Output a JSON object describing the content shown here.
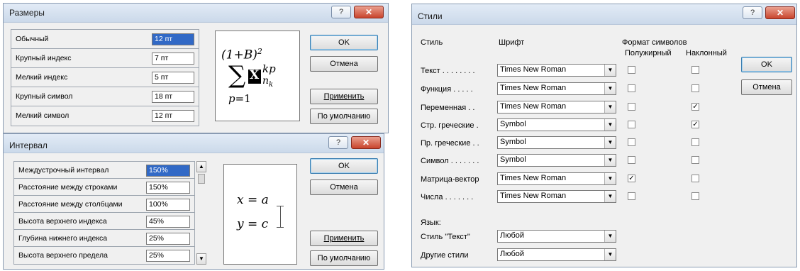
{
  "sizes": {
    "title": "Размеры",
    "help": "?",
    "close": "✕",
    "rows": [
      {
        "label": "Обычный",
        "value": "12 пт"
      },
      {
        "label": "Крупный индекс",
        "value": "7 пт"
      },
      {
        "label": "Мелкий индекс",
        "value": "5 пт"
      },
      {
        "label": "Крупный символ",
        "value": "18 пт"
      },
      {
        "label": "Мелкий символ",
        "value": "12 пт"
      }
    ],
    "buttons": {
      "ok": "OK",
      "cancel": "Отмена",
      "apply": "Применить",
      "default": "По умолчанию"
    }
  },
  "interval": {
    "title": "Интервал",
    "help": "?",
    "close": "✕",
    "rows": [
      {
        "label": "Междустрочный интервал",
        "value": "150%"
      },
      {
        "label": "Расстояние между строками",
        "value": "150%"
      },
      {
        "label": "Расстояние между столбцами",
        "value": "100%"
      },
      {
        "label": "Высота верхнего индекса",
        "value": "45%"
      },
      {
        "label": "Глубина нижнего индекса",
        "value": "25%"
      },
      {
        "label": "Высота верхнего предела",
        "value": "25%"
      }
    ],
    "buttons": {
      "ok": "OK",
      "cancel": "Отмена",
      "apply": "Применить",
      "default": "По умолчанию"
    }
  },
  "styles": {
    "title": "Стили",
    "help": "?",
    "close": "✕",
    "headers": {
      "style": "Стиль",
      "font": "Шрифт",
      "format": "Формат символов",
      "bold": "Полужирный",
      "italic": "Наклонный"
    },
    "rows": [
      {
        "label": "Текст . . . . . . . .",
        "font": "Times New Roman",
        "bold": false,
        "italic": false
      },
      {
        "label": "Функция . . . . .",
        "font": "Times New Roman",
        "bold": false,
        "italic": false
      },
      {
        "label": "Переменная . .",
        "font": "Times New Roman",
        "bold": false,
        "italic": true
      },
      {
        "label": "Стр. греческие .",
        "font": "Symbol",
        "bold": false,
        "italic": true
      },
      {
        "label": "Пр. греческие . .",
        "font": "Symbol",
        "bold": false,
        "italic": false
      },
      {
        "label": "Символ . . . . . . .",
        "font": "Symbol",
        "bold": false,
        "italic": false
      },
      {
        "label": "Матрица-вектор",
        "font": "Times New Roman",
        "bold": true,
        "italic": false
      },
      {
        "label": "Числа . . . . . . .",
        "font": "Times New Roman",
        "bold": false,
        "italic": false
      }
    ],
    "language": {
      "label": "Язык:",
      "rows": [
        {
          "label": "Стиль \"Текст\"",
          "value": "Любой"
        },
        {
          "label": "Другие стили",
          "value": "Любой"
        }
      ]
    },
    "buttons": {
      "ok": "OK",
      "cancel": "Отмена"
    }
  }
}
